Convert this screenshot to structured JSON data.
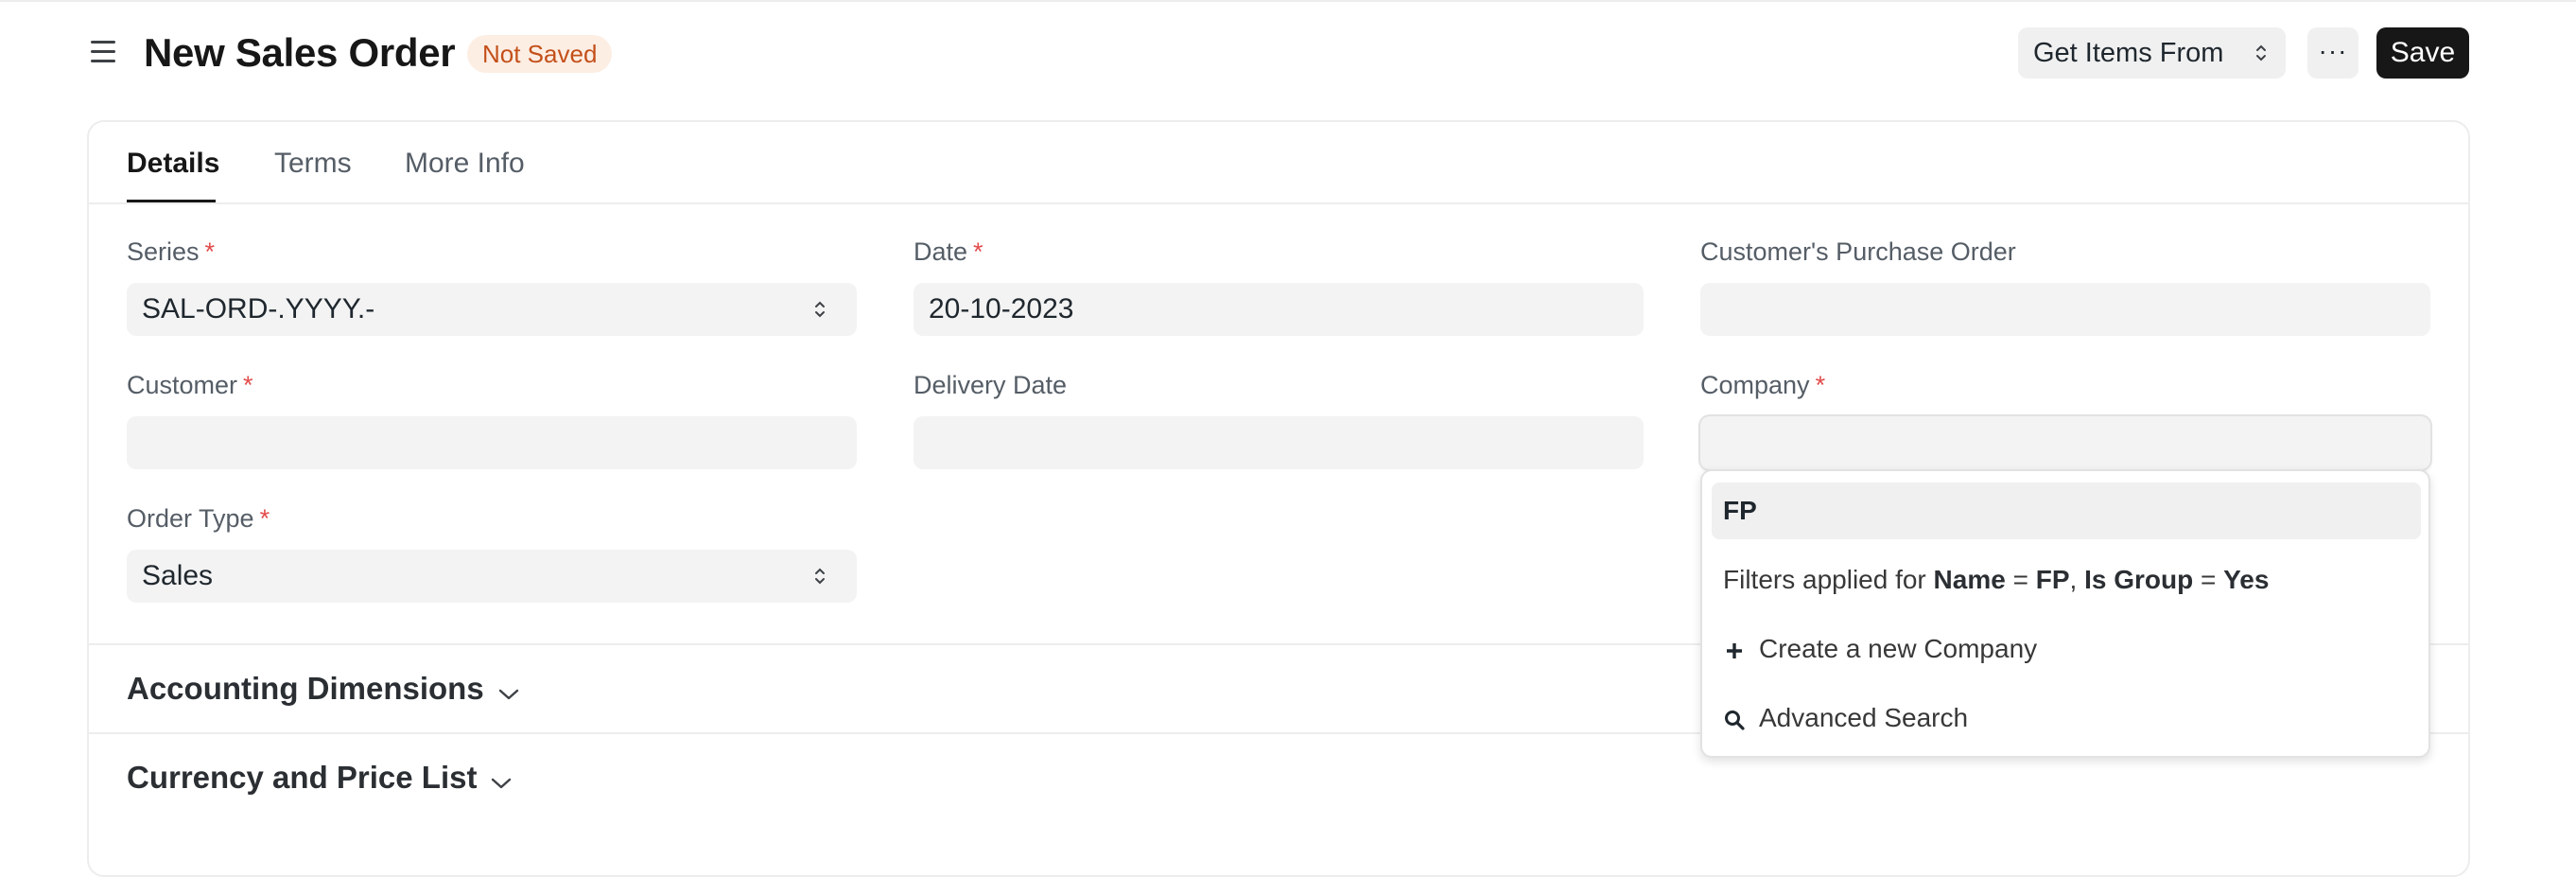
{
  "header": {
    "title": "New Sales Order",
    "status_badge": "Not Saved",
    "get_items_label": "Get Items From",
    "more_label": "···",
    "save_label": "Save"
  },
  "tabs": [
    {
      "label": "Details",
      "active": true
    },
    {
      "label": "Terms",
      "active": false
    },
    {
      "label": "More Info",
      "active": false
    }
  ],
  "fields": {
    "series": {
      "label": "Series",
      "value": "SAL-ORD-.YYYY.-",
      "required": "*"
    },
    "date": {
      "label": "Date",
      "value": "20-10-2023",
      "required": "*"
    },
    "customer_po": {
      "label": "Customer's Purchase Order",
      "value": ""
    },
    "customer": {
      "label": "Customer",
      "value": "",
      "required": "*"
    },
    "delivery_date": {
      "label": "Delivery Date",
      "value": ""
    },
    "company": {
      "label": "Company",
      "value": "",
      "required": "*"
    },
    "order_type": {
      "label": "Order Type",
      "value": "Sales",
      "required": "*"
    }
  },
  "sections": [
    {
      "title": "Accounting Dimensions"
    },
    {
      "title": "Currency and Price List"
    }
  ],
  "company_dropdown": {
    "first_result": "FP",
    "filters_prefix": "Filters applied for ",
    "filter_name_key": "Name",
    "filter_name_value": "FP",
    "filter_group_key": "Is Group",
    "filter_group_value": "Yes",
    "equals": "=",
    "comma": ",",
    "create_new_label": "Create a new Company",
    "advanced_search_label": "Advanced Search"
  },
  "icons": {
    "menu": "hamburger-icon",
    "updown": "up-down-arrows-icon",
    "chevron": "chevron-down-icon",
    "plus": "plus-icon",
    "search": "search-icon"
  }
}
